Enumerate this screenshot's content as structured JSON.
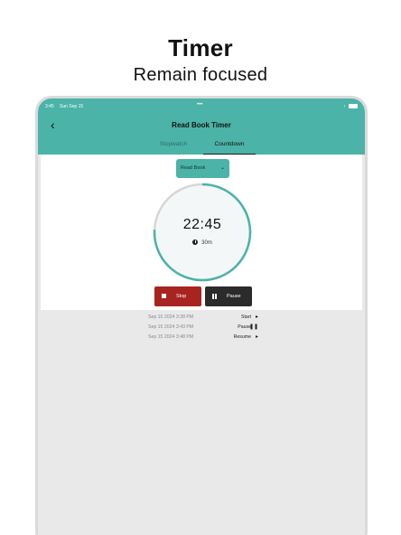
{
  "promo": {
    "title": "Timer",
    "subtitle": "Remain focused"
  },
  "status_bar": {
    "time": "3:45",
    "date": "Sun Sep 15",
    "dots": "•••"
  },
  "nav": {
    "title": "Read Book Timer",
    "back_icon": "chevron-left-icon"
  },
  "tabs": [
    {
      "label": "Stopwatch",
      "active": false
    },
    {
      "label": "Countdown",
      "active": true
    }
  ],
  "timer": {
    "activity_selected": "Read Book",
    "time_remaining": "22:45",
    "duration": "30m",
    "progress_fraction": 0.242
  },
  "buttons": {
    "stop_label": "Stop",
    "pause_label": "Pause"
  },
  "log": [
    {
      "timestamp": "Sep 15 2024 3:38 PM",
      "action": "Start",
      "icon": "play-icon"
    },
    {
      "timestamp": "Sep 15 2024 3:43 PM",
      "action": "Pause",
      "icon": "pause-icon"
    },
    {
      "timestamp": "Sep 15 2024 3:48 PM",
      "action": "Resume",
      "icon": "play-icon"
    }
  ],
  "colors": {
    "accent": "#4bb3a8",
    "stop": "#a82421",
    "pause": "#2b2b2b"
  }
}
